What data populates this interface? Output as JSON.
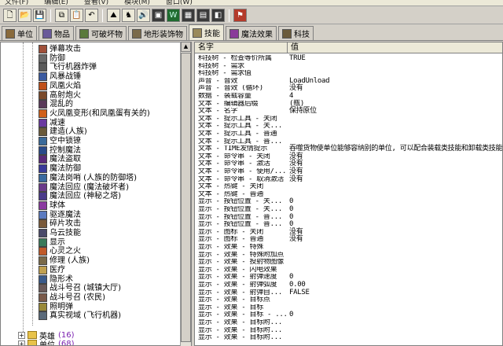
{
  "menu": [
    "文件(F)",
    "编辑(E)",
    "查看(V)",
    "模块(M)",
    "窗口(W)"
  ],
  "toolbar": {
    "buttons": [
      {
        "name": "new-file-icon",
        "glyph": "🗋"
      },
      {
        "name": "open-folder-icon",
        "glyph": "📂"
      },
      {
        "name": "save-icon",
        "glyph": "💾"
      },
      {
        "name": "copy-icon",
        "glyph": "⧉"
      },
      {
        "name": "paste-icon",
        "glyph": "📋"
      },
      {
        "name": "undo-icon",
        "glyph": "↶"
      },
      {
        "name": "terrain-editor-icon",
        "glyph": "⛰"
      },
      {
        "name": "trigger-editor-icon",
        "glyph": "♞"
      },
      {
        "name": "sound-editor-icon",
        "glyph": "🔊"
      },
      {
        "name": "object-editor-icon",
        "glyph": "▣"
      },
      {
        "name": "campaign-editor-icon",
        "glyph": "W"
      },
      {
        "name": "ai-editor-icon",
        "glyph": "▦"
      },
      {
        "name": "import-manager-icon",
        "glyph": "▤"
      },
      {
        "name": "script-editor-icon",
        "glyph": "◧"
      },
      {
        "name": "test-map-icon",
        "glyph": "⚑"
      }
    ]
  },
  "tabs": [
    {
      "label": "单位",
      "color": "#8a6a3a"
    },
    {
      "label": "物品",
      "color": "#6a5a9a"
    },
    {
      "label": "可破坏物",
      "color": "#5a7a3a"
    },
    {
      "label": "地形装饰物",
      "color": "#7a6a4a"
    },
    {
      "label": "技能",
      "color": "#9a8a5a",
      "active": true
    },
    {
      "label": "魔法效果",
      "color": "#8a3a9a"
    },
    {
      "label": "科技",
      "color": "#6a5a3a"
    }
  ],
  "tree": {
    "items": [
      {
        "label": "弹幕攻击",
        "color": "#a0503a"
      },
      {
        "label": "防御",
        "color": "#6a6a6a"
      },
      {
        "label": "飞行机器炸弹",
        "color": "#5a5a5a"
      },
      {
        "label": "风暴战锤",
        "color": "#3a5aa0"
      },
      {
        "label": "凤凰火焰",
        "color": "#c0501a"
      },
      {
        "label": "高射炮火",
        "color": "#7a4a2a"
      },
      {
        "label": "混乱的",
        "color": "#5a3a5a"
      },
      {
        "label": "火凤凰变形(和凤凰蛋有关的)",
        "color": "#d0601a"
      },
      {
        "label": "减速",
        "color": "#6a3aa0"
      },
      {
        "label": "建造(人族)",
        "color": "#6a5a3a"
      },
      {
        "label": "空中锁镣",
        "color": "#3a6a9a"
      },
      {
        "label": "控制魔法",
        "color": "#2a4a8a"
      },
      {
        "label": "魔法盗取",
        "color": "#5a2a7a"
      },
      {
        "label": "魔法防御",
        "color": "#3a3a9a"
      },
      {
        "label": "魔法岗哨 (人族的防御塔)",
        "color": "#3a6aa0"
      },
      {
        "label": "魔法回应 (魔法破坏者)",
        "color": "#6a3a8a"
      },
      {
        "label": "魔法回应 (神秘之塔)",
        "color": "#4a3a8a"
      },
      {
        "label": "球体",
        "color": "#8a3aa0"
      },
      {
        "label": "驱逐魔法",
        "color": "#5a7ac0"
      },
      {
        "label": "碎片攻击",
        "color": "#7a5a3a"
      },
      {
        "label": "乌云技能",
        "color": "#4a4a6a"
      },
      {
        "label": "显示",
        "color": "#3a7a5a"
      },
      {
        "label": "心灵之火",
        "color": "#c05a2a"
      },
      {
        "label": "修理 (人族)",
        "color": "#7a6a4a"
      },
      {
        "label": "医疗",
        "color": "#c0a050"
      },
      {
        "label": "隐形术",
        "color": "#3a5a8a"
      },
      {
        "label": "战斗号召 (城镇大厅)",
        "color": "#6a5a5a"
      },
      {
        "label": "战斗号召 (农民)",
        "color": "#7a5a4a"
      },
      {
        "label": "照明弹",
        "color": "#9a8a3a"
      },
      {
        "label": "真实视域 (飞行机器)",
        "color": "#5a6a7a"
      }
    ],
    "folders": [
      {
        "label": "英雄",
        "count": "(16)"
      },
      {
        "label": "单位",
        "count": "(68)"
      }
    ]
  },
  "properties": {
    "header": {
      "name": "名字",
      "value": "值"
    },
    "rows": [
      {
        "k": "科技树 - 检查等价所属",
        "v": "TRUE"
      },
      {
        "k": "科技树 - 需求",
        "v": ""
      },
      {
        "k": "科技树 - 需求值",
        "v": ""
      },
      {
        "k": "声音 - 音效",
        "v": "LoadUnload"
      },
      {
        "k": "声音 - 音效 (循环)",
        "v": "没有"
      },
      {
        "k": "数据 - 装载容量",
        "v": "4"
      },
      {
        "k": "文本 - 编辑器后缀",
        "v": "(瓶)"
      },
      {
        "k": "文本 - 名字",
        "v": "保持原位"
      },
      {
        "k": "文本 - 提示工具 - 关闭",
        "v": ""
      },
      {
        "k": "文本 - 提示工具 - 关...",
        "v": ""
      },
      {
        "k": "文本 - 提示工具 - 普通",
        "v": ""
      },
      {
        "k": "文本 - 提示工具 - 普...",
        "v": ""
      },
      {
        "k": "文本 - TIME发情提示",
        "v": "吞噬货物使单位能够容纳别的单位, 可以配合装载类技能和卸载类技能"
      },
      {
        "k": "文本 - 命令串 - 关闭",
        "v": "没有"
      },
      {
        "k": "文本 - 命令串 - 激活",
        "v": "没有"
      },
      {
        "k": "文本 - 命令串 - 使用/...",
        "v": "没有"
      },
      {
        "k": "文本 - 命令串 - 取消激活",
        "v": "没有"
      },
      {
        "k": "文本 - 热键 - 关闭",
        "v": ""
      },
      {
        "k": "文本 - 热键 - 普通",
        "v": ""
      },
      {
        "k": "显示 - 按钮位置 - 关...",
        "v": "0"
      },
      {
        "k": "显示 - 按钮位置 - 关...",
        "v": "0"
      },
      {
        "k": "显示 - 按钮位置 - 普...",
        "v": "0"
      },
      {
        "k": "显示 - 按钮位置 - 普...",
        "v": "0"
      },
      {
        "k": "显示 - 图标 - 关闭",
        "v": "没有"
      },
      {
        "k": "显示 - 图标 - 普通",
        "v": "没有"
      },
      {
        "k": "显示 - 效果 - 特殊",
        "v": ""
      },
      {
        "k": "显示 - 效果 - 特殊附加点",
        "v": ""
      },
      {
        "k": "显示 - 效果 - 投射物图像",
        "v": ""
      },
      {
        "k": "显示 - 效果 - 闪电效果",
        "v": ""
      },
      {
        "k": "显示 - 效果 - 射弹速度",
        "v": "0"
      },
      {
        "k": "显示 - 效果 - 射弹弧度",
        "v": "0.00"
      },
      {
        "k": "显示 - 效果 - 射弹自...",
        "v": "FALSE"
      },
      {
        "k": "显示 - 效果 - 目标点",
        "v": ""
      },
      {
        "k": "显示 - 效果 - 目标",
        "v": ""
      },
      {
        "k": "显示 - 效果 - 目标 - ...",
        "v": "0"
      },
      {
        "k": "显示 - 效果 - 目标附...",
        "v": ""
      },
      {
        "k": "显示 - 效果 - 目标附...",
        "v": ""
      },
      {
        "k": "显示 - 效果 - 目标附...",
        "v": ""
      }
    ]
  }
}
